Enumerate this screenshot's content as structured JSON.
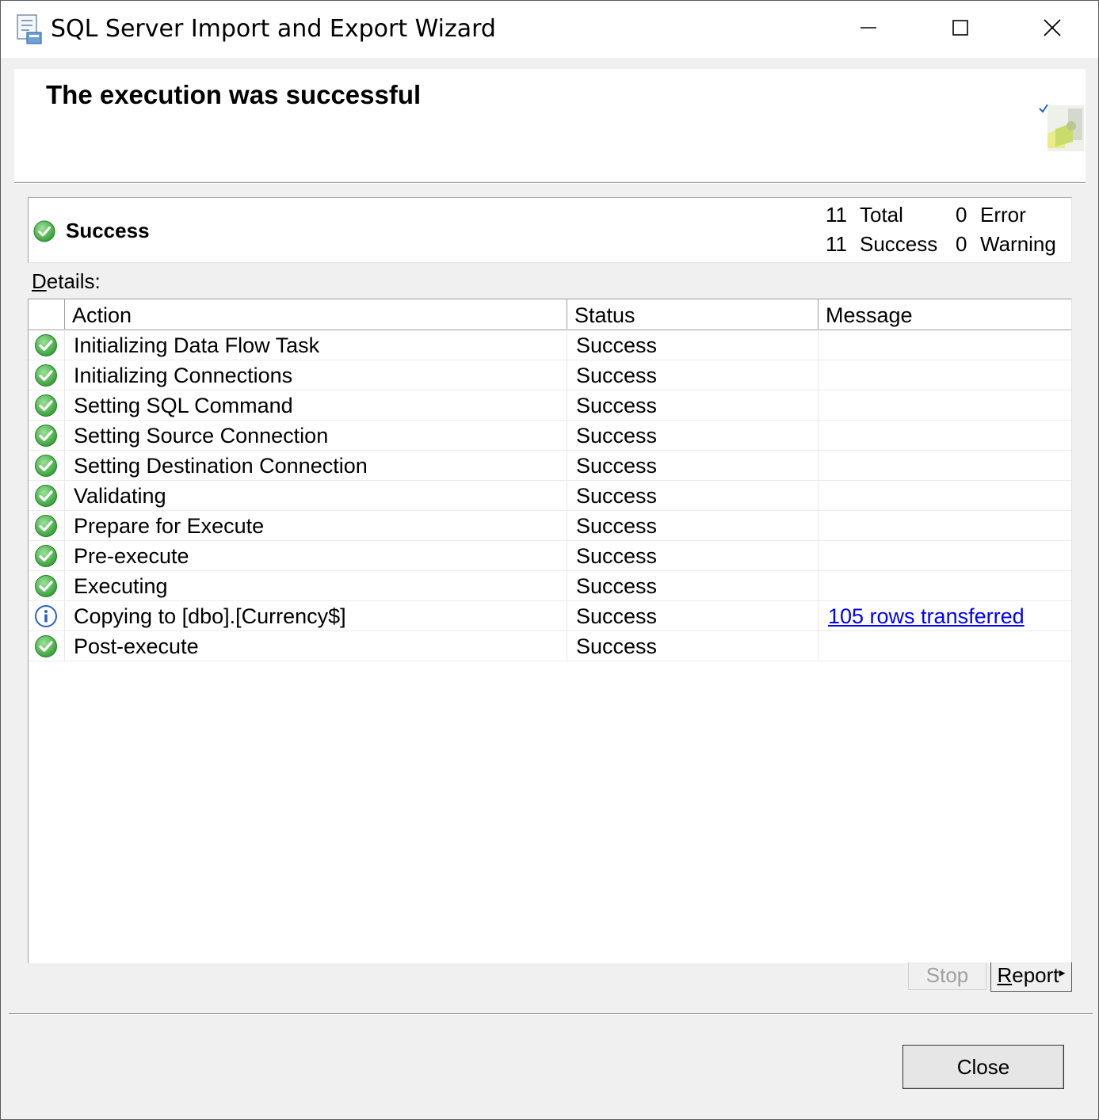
{
  "window": {
    "title": "SQL Server Import and Export Wizard",
    "icons": {
      "app": "wizard-app-icon",
      "minimize": "minimize-icon",
      "maximize": "maximize-icon",
      "close": "close-icon"
    }
  },
  "header": {
    "title": "The execution was successful",
    "icon": "wizard-success-graphic-icon"
  },
  "summary": {
    "status": "Success",
    "status_icon": "success-check-icon",
    "total_count": "11",
    "total_label": "Total",
    "success_count": "11",
    "success_label": "Success",
    "error_count": "0",
    "error_label": "Error",
    "warning_count": "0",
    "warning_label": "Warning"
  },
  "details": {
    "label_first": "D",
    "label_rest": "etails:",
    "columns": [
      "Action",
      "Status",
      "Message"
    ],
    "rows": [
      {
        "icon": "success-check-icon",
        "action": "Initializing Data Flow Task",
        "status": "Success",
        "message": ""
      },
      {
        "icon": "success-check-icon",
        "action": "Initializing Connections",
        "status": "Success",
        "message": ""
      },
      {
        "icon": "success-check-icon",
        "action": "Setting SQL Command",
        "status": "Success",
        "message": ""
      },
      {
        "icon": "success-check-icon",
        "action": "Setting Source Connection",
        "status": "Success",
        "message": ""
      },
      {
        "icon": "success-check-icon",
        "action": "Setting Destination Connection",
        "status": "Success",
        "message": ""
      },
      {
        "icon": "success-check-icon",
        "action": "Validating",
        "status": "Success",
        "message": ""
      },
      {
        "icon": "success-check-icon",
        "action": "Prepare for Execute",
        "status": "Success",
        "message": ""
      },
      {
        "icon": "success-check-icon",
        "action": "Pre-execute",
        "status": "Success",
        "message": ""
      },
      {
        "icon": "success-check-icon",
        "action": "Executing",
        "status": "Success",
        "message": ""
      },
      {
        "icon": "info-icon",
        "action": "Copying to [dbo].[Currency$]",
        "status": "Success",
        "message": "105 rows transferred"
      },
      {
        "icon": "success-check-icon",
        "action": "Post-execute",
        "status": "Success",
        "message": ""
      }
    ]
  },
  "buttons": {
    "stop": "Stop",
    "report_first": "R",
    "report_rest": "eport",
    "report_arrow": "▸",
    "close": "Close"
  },
  "colors": {
    "success_green": "#3aa53a",
    "info_blue": "#2b62c4",
    "link": "#0000ff"
  }
}
